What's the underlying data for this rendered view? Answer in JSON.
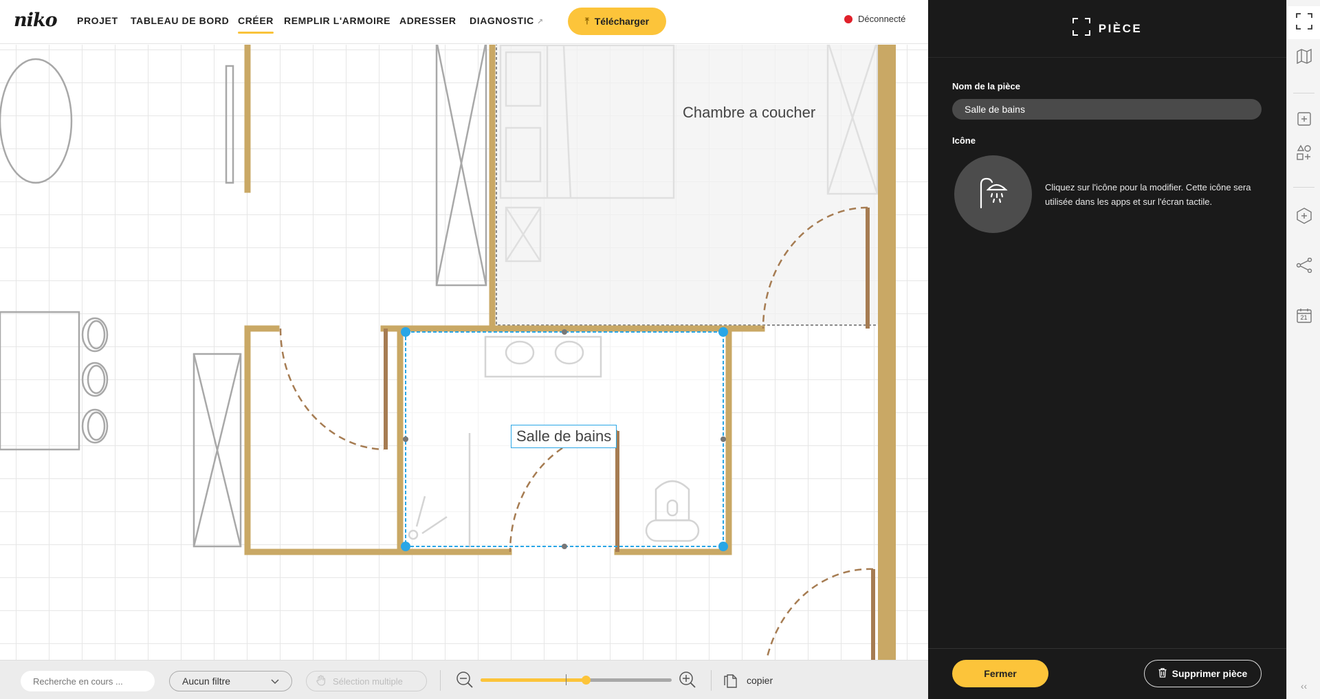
{
  "app": {
    "logo": "niko"
  },
  "nav": {
    "projet": "PROJET",
    "tableau": "TABLEAU DE BORD",
    "creer": "CRÉER",
    "remplir": "REMPLIR L'ARMOIRE",
    "adresser": "ADRESSER",
    "diagnostic": "DIAGNOSTIC",
    "active": "CRÉER"
  },
  "header": {
    "download_label": "Télécharger",
    "status_label": "Déconnecté",
    "status_color": "#e0202a"
  },
  "floorplan": {
    "rooms": [
      {
        "name": "Chambre a coucher"
      },
      {
        "name": "Salle de bains",
        "selected": true
      }
    ],
    "wall_color": "#c9a865",
    "door_color": "#a67c52",
    "selection_color": "#29a6e6"
  },
  "toolbar": {
    "search_placeholder": "Recherche en cours ...",
    "filter_value": "Aucun filtre",
    "multi_select_label": "Sélection multiple",
    "zoom_level": 0.55,
    "copy_label": "copier"
  },
  "panel": {
    "title": "PIÈCE",
    "room_name_label": "Nom de la pièce",
    "room_name_value": "Salle de bains",
    "icon_label": "Icône",
    "icon_name": "shower-icon",
    "icon_help": "Cliquez sur l'icône pour la modifier. Cette icône sera utilisée dans les apps et sur l'écran tactile.",
    "close_label": "Fermer",
    "delete_label": "Supprimer pièce"
  },
  "rail": {
    "icons": [
      "room-outline-icon",
      "map-icon",
      "add-square-icon",
      "shapes-add-icon",
      "hexagon-add-icon",
      "connections-icon",
      "calendar-icon"
    ],
    "calendar_day": "21"
  },
  "colors": {
    "accent": "#fcc43a",
    "panel_bg": "#1a1a1a"
  }
}
